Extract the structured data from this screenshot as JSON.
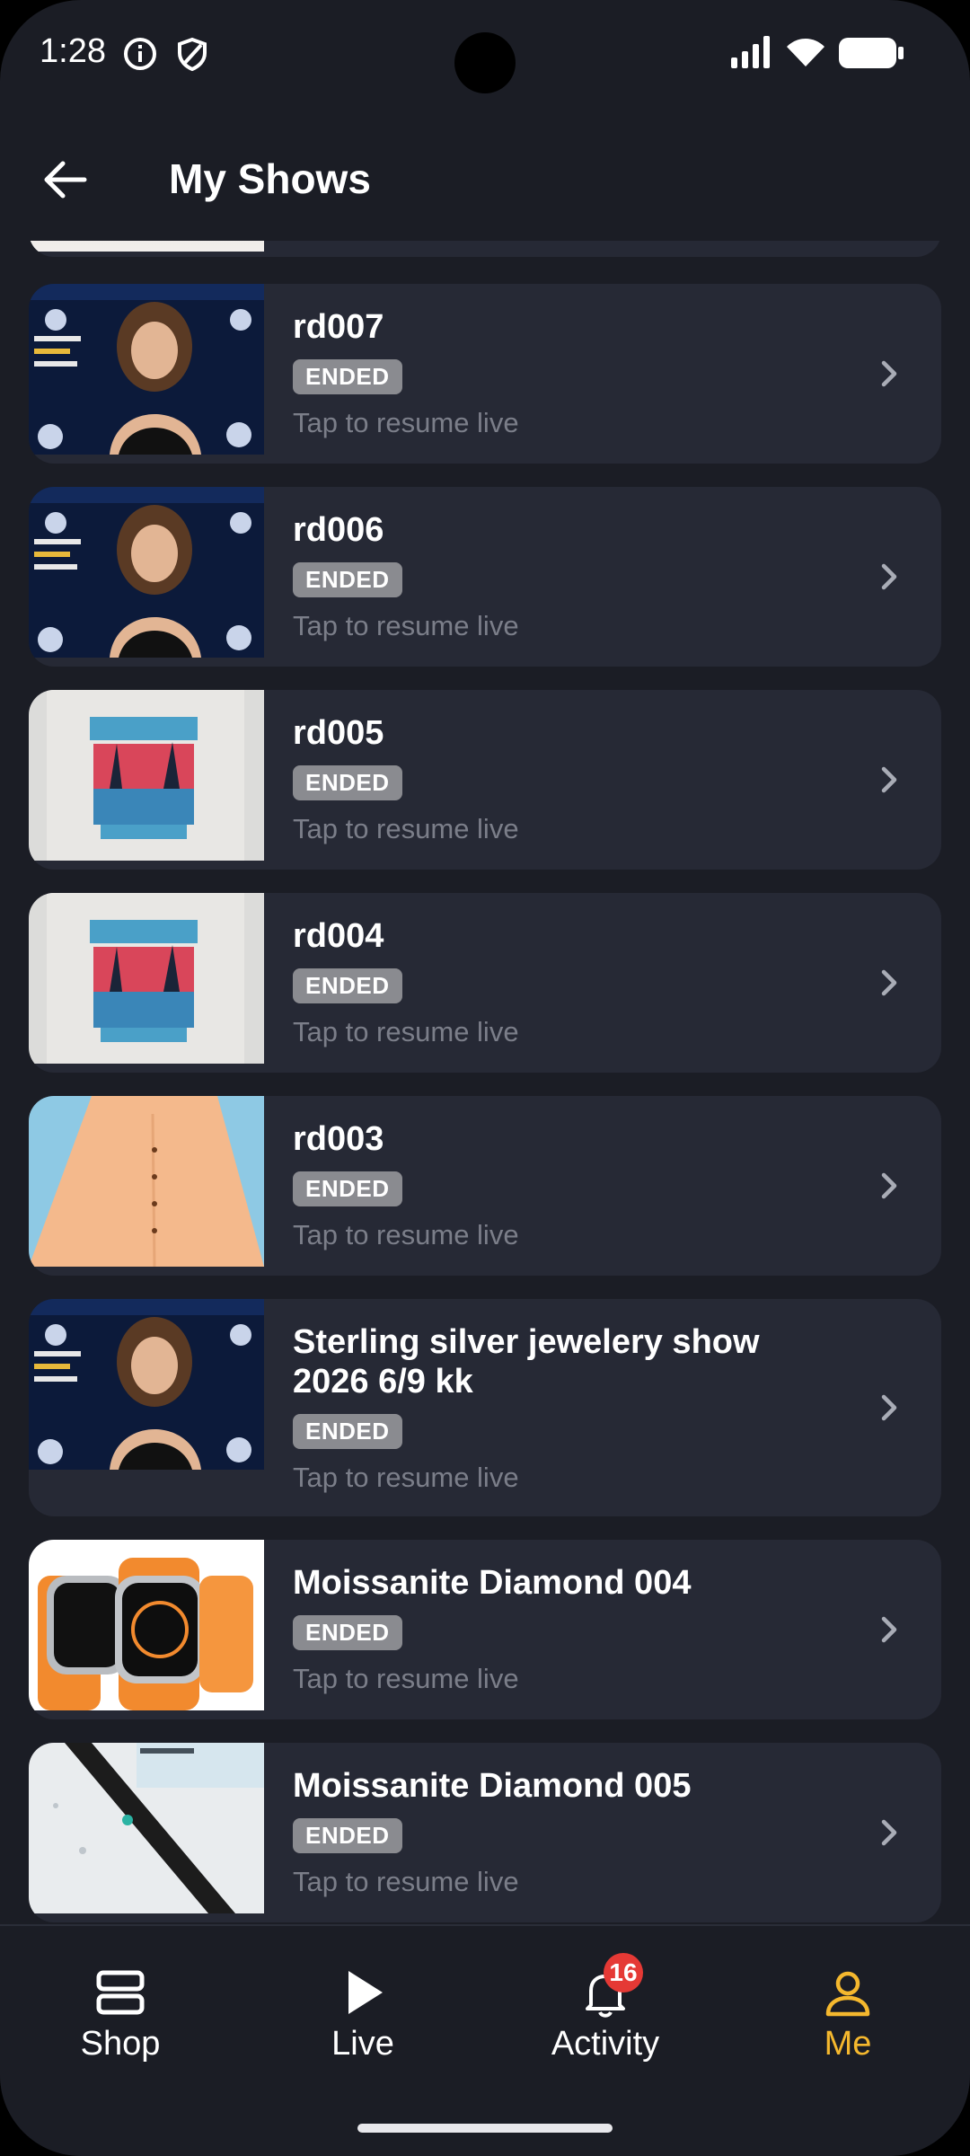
{
  "status_bar": {
    "time": "1:28"
  },
  "header": {
    "title": "My Shows"
  },
  "shows": [
    {
      "title": "rd007",
      "status": "ENDED",
      "subtitle": "Tap to resume live",
      "thumb": "jewelry-ad"
    },
    {
      "title": "rd006",
      "status": "ENDED",
      "subtitle": "Tap to resume live",
      "thumb": "jewelry-ad"
    },
    {
      "title": "rd005",
      "status": "ENDED",
      "subtitle": "Tap to resume live",
      "thumb": "tshirt"
    },
    {
      "title": "rd004",
      "status": "ENDED",
      "subtitle": "Tap to resume live",
      "thumb": "tshirt"
    },
    {
      "title": "rd003",
      "status": "ENDED",
      "subtitle": "Tap to resume live",
      "thumb": "skirt"
    },
    {
      "title": "Sterling silver jewelery show 2026 6/9 kk",
      "status": "ENDED",
      "subtitle": "Tap to resume live",
      "thumb": "jewelry-ad"
    },
    {
      "title": "Moissanite Diamond 004",
      "status": "ENDED",
      "subtitle": "Tap to resume live",
      "thumb": "watches"
    },
    {
      "title": "Moissanite Diamond 005",
      "status": "ENDED",
      "subtitle": "Tap to resume live",
      "thumb": "toothbrush"
    }
  ],
  "bottom_nav": {
    "shop": "Shop",
    "live": "Live",
    "activity": "Activity",
    "activity_badge": "16",
    "me": "Me"
  },
  "colors": {
    "accent": "#f5b82e",
    "card": "#262935",
    "background": "#1b1d25",
    "badge_red": "#e53935"
  }
}
